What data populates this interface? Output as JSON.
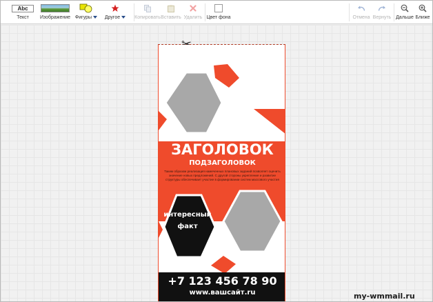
{
  "toolbar": {
    "text_label": "Текст",
    "text_icon": "Abc",
    "image_label": "Изображение",
    "shapes_label": "Фигуры",
    "other_label": "Другое",
    "copy_label": "Копировать",
    "paste_label": "Вставить",
    "delete_label": "Удалить",
    "bgcolor_label": "Цвет фона",
    "undo_label": "Отмена",
    "redo_label": "Вернуть",
    "zoom_out_label": "Дальше",
    "zoom_in_label": "Ближе",
    "icons": {
      "shapes": "shapes-icon",
      "other": "star-icon",
      "copy": "copy-icon",
      "paste": "paste-icon",
      "delete": "delete-x-icon",
      "undo": "undo-icon",
      "redo": "redo-icon",
      "zoom_out": "magnifier-minus-icon",
      "zoom_in": "magnifier-plus-icon"
    }
  },
  "banner": {
    "title": "ЗАГОЛОВОК",
    "subtitle": "ПОДЗАГОЛОВОК",
    "body": "Таким образом реализация намеченных плановых заданий позволяет оценить значение новых предложений. С другой стороны укрепление и развитие структуры обеспечивает участие в формировании систем массового участия",
    "fact_line1": "интересный",
    "fact_line2": "факт",
    "phone": "+7 123 456 78 90",
    "website": "www.вашсайт.ru",
    "scissors": "✂",
    "colors": {
      "accent": "#ef4b2c",
      "placeholder": "#a8a8a8",
      "dark": "#111111",
      "white": "#ffffff"
    }
  },
  "watermark": "my-wmmail.ru"
}
